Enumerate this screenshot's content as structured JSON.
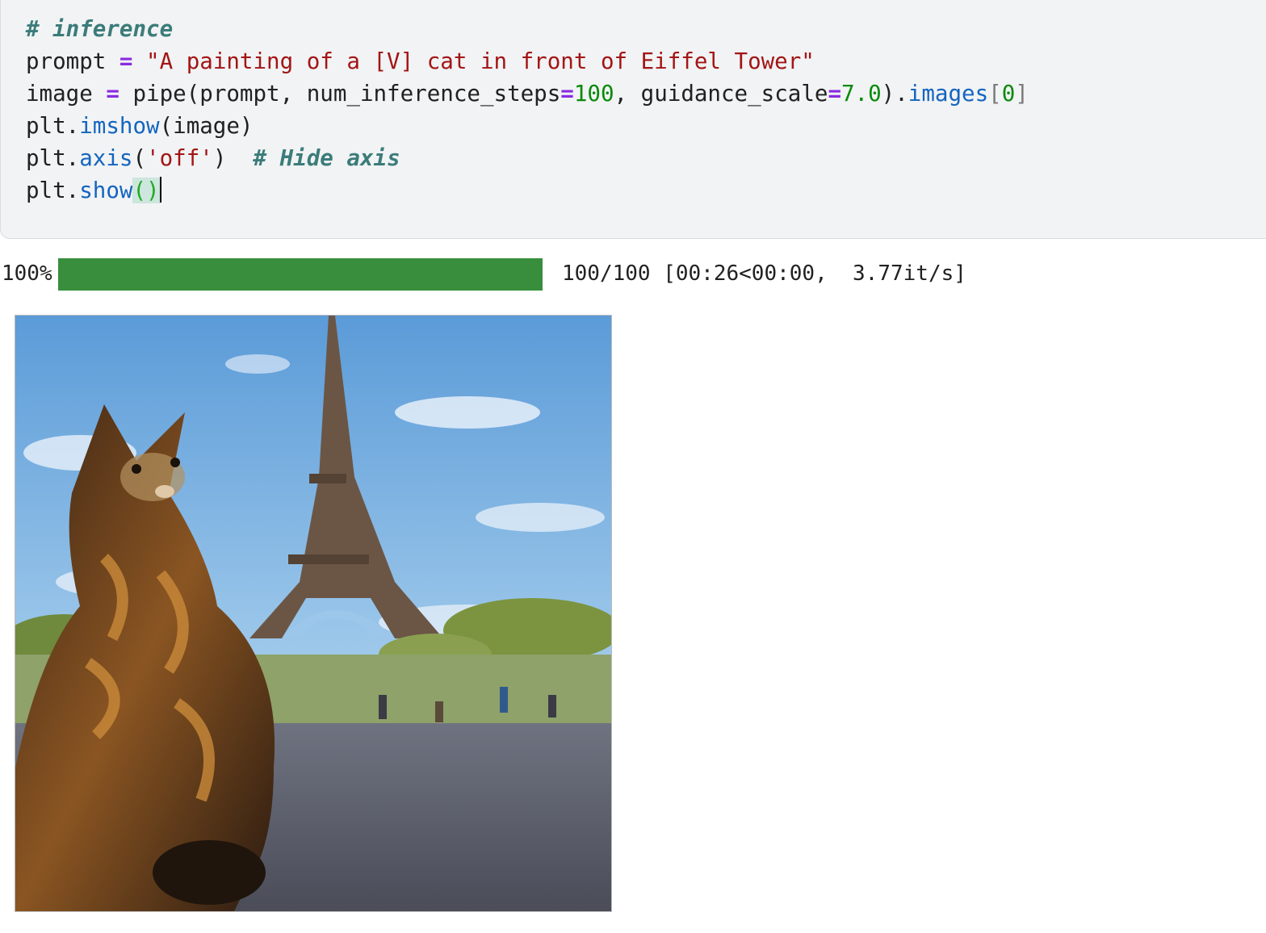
{
  "code_cell": {
    "comment": "# inference",
    "line2": {
      "var": "prompt",
      "eq": "=",
      "str": "\"A painting of a [V] cat in front of Eiffel Tower\""
    },
    "line3": {
      "var": "image",
      "eq": "=",
      "call": "pipe(prompt, num_inference_steps",
      "eq2": "=",
      "steps": "100",
      "sep": ", guidance_scale",
      "eq3": "=",
      "scale": "7.0",
      "close": ").",
      "attr": "images",
      "lbr": "[",
      "idx": "0",
      "rbr": "]"
    },
    "line4": {
      "obj": "plt.",
      "fn": "imshow",
      "args": "(image)"
    },
    "line5": {
      "obj": "plt.",
      "fn": "axis",
      "lp": "(",
      "str": "'off'",
      "rp": ")",
      "gap": "  ",
      "comment": "# Hide axis"
    },
    "line6": {
      "obj": "plt.",
      "fn": "show",
      "parens": "()"
    }
  },
  "progress": {
    "percent_label": "100%",
    "fraction": 1.0,
    "status_text": "100/100 [00:26<00:00,  3.77it/s]",
    "bar_color": "#388e3c"
  },
  "output": {
    "icon": "generated-image-cat-eiffel-tower"
  },
  "colors": {
    "cell_bg": "#f1f3f4",
    "comment": "#3b7c7a",
    "string": "#a31515",
    "operator": "#8a2be2",
    "function": "#1565c0",
    "number": "#0a8a0a"
  }
}
